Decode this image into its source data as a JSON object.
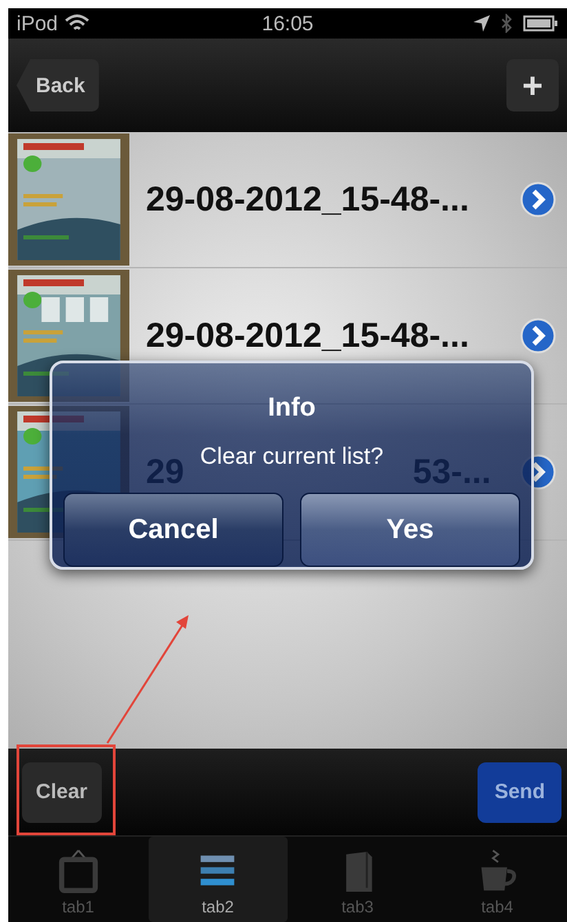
{
  "status_bar": {
    "carrier": "iPod",
    "time": "16:05"
  },
  "nav_bar": {
    "back": "Back",
    "add": "+"
  },
  "rows": [
    {
      "title": "29-08-2012_15-48-..."
    },
    {
      "title": "29-08-2012_15-48-..."
    },
    {
      "title_parts": [
        "29",
        "53-..."
      ]
    }
  ],
  "alert": {
    "title": "Info",
    "message": "Clear current list?",
    "buttons": [
      "Cancel",
      "Yes"
    ]
  },
  "toolbar": {
    "clear": "Clear",
    "send": "Send"
  },
  "tabs": [
    {
      "label": "tab1",
      "selected": false
    },
    {
      "label": "tab2",
      "selected": true
    },
    {
      "label": "tab3",
      "selected": false
    },
    {
      "label": "tab4",
      "selected": false
    }
  ]
}
